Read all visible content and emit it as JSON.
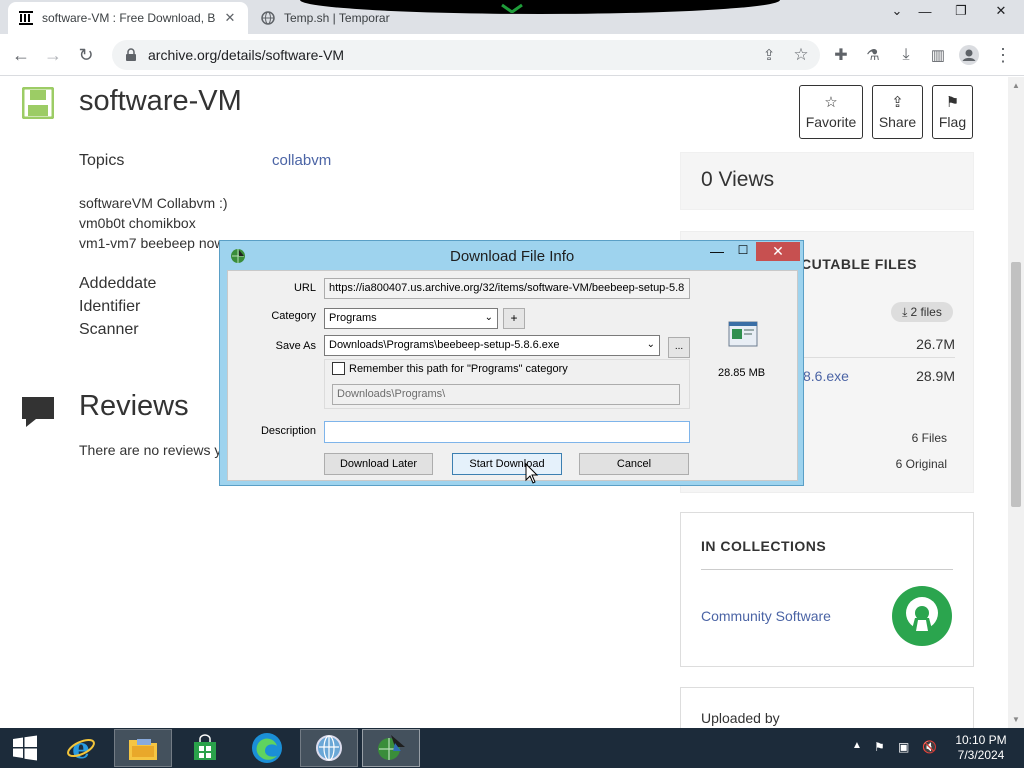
{
  "browser": {
    "tabs": [
      {
        "title": "software-VM : Free Download, B",
        "active": true
      },
      {
        "title": "Temp.sh | Temporary File Up",
        "active": false
      }
    ],
    "url": "archive.org/details/software-VM"
  },
  "page": {
    "title": "software-VM",
    "actions": {
      "favorite": "Favorite",
      "share": "Share",
      "flag": "Flag"
    },
    "topics_label": "Topics",
    "topics_value": "collabvm",
    "description_lines": [
      "softwareVM Collabvm :)",
      "vm0b0t chomikbox",
      "vm1-vm7 beebeep now"
    ],
    "meta_labels": [
      "Addeddate",
      "Identifier",
      "Scanner"
    ],
    "reviews_title": "Reviews",
    "reviews_text": "There are no reviews y",
    "views": "0 Views",
    "files_heading": "CUTABLE FILES",
    "files_pill": "2 files",
    "files": [
      {
        "name": "",
        "size": "26.7M"
      },
      {
        "name": "8.6.exe",
        "size": "28.9M"
      }
    ],
    "files_count": "6 Files",
    "files_original": "6 Original",
    "collections_heading": "IN COLLECTIONS",
    "collection_link": "Community Software",
    "uploaded_by": "Uploaded by",
    "colors": {
      "link": "#4b64a5",
      "accent_green": "#2ba54e"
    }
  },
  "dialog": {
    "title": "Download File Info",
    "url_label": "URL",
    "url_value": "https://ia800407.us.archive.org/32/items/software-VM/beebeep-setup-5.8",
    "category_label": "Category",
    "category_value": "Programs",
    "plus": "+",
    "save_as_label": "Save As",
    "save_as_value": "Downloads\\Programs\\beebeep-setup-5.8.6.exe",
    "browse": "...",
    "remember_label": "Remember this path for \"Programs\" category",
    "remember_checked": false,
    "path_value": "Downloads\\Programs\\",
    "description_label": "Description",
    "description_value": "",
    "size": "28.85 MB",
    "btn_later": "Download Later",
    "btn_start": "Start Download",
    "btn_cancel": "Cancel"
  },
  "taskbar": {
    "time": "10:10 PM",
    "date": "7/3/2024"
  }
}
